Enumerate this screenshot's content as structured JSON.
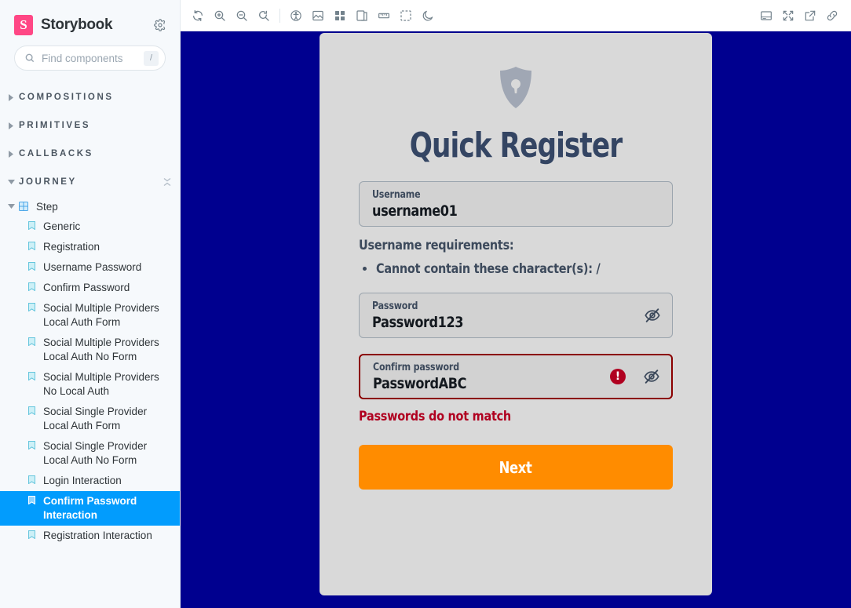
{
  "sidebar": {
    "brand": "Storybook",
    "brand_mark": "S",
    "settings_icon": "gear-icon",
    "search": {
      "placeholder": "Find components",
      "value": "",
      "shortcut": "/"
    },
    "groups": [
      {
        "label": "COMPOSITIONS",
        "expanded": false
      },
      {
        "label": "PRIMITIVES",
        "expanded": false
      },
      {
        "label": "CALLBACKS",
        "expanded": false
      },
      {
        "label": "JOURNEY",
        "expanded": true
      }
    ],
    "component": {
      "label": "Step",
      "expanded": true
    },
    "stories": [
      {
        "label": "Generic",
        "selected": false
      },
      {
        "label": "Registration",
        "selected": false
      },
      {
        "label": "Username Password",
        "selected": false
      },
      {
        "label": "Confirm Password",
        "selected": false
      },
      {
        "label": "Social Multiple Providers Local Auth Form",
        "selected": false
      },
      {
        "label": "Social Multiple Providers Local Auth No Form",
        "selected": false
      },
      {
        "label": "Social Multiple Providers No Local Auth",
        "selected": false
      },
      {
        "label": "Social Single Provider Local Auth Form",
        "selected": false
      },
      {
        "label": "Social Single Provider Local Auth No Form",
        "selected": false
      },
      {
        "label": "Login Interaction",
        "selected": false
      },
      {
        "label": "Confirm Password Interaction",
        "selected": true
      },
      {
        "label": "Registration Interaction",
        "selected": false
      }
    ]
  },
  "toolbar": {
    "left_icons": [
      "remount-icon",
      "zoom-in-icon",
      "zoom-out-icon",
      "zoom-reset-icon",
      "accessibility-icon",
      "backgrounds-icon",
      "grid-icon",
      "viewport-icon",
      "measure-icon",
      "outline-icon",
      "dark-mode-icon"
    ],
    "right_icons": [
      "addons-panel-icon",
      "fullscreen-icon",
      "open-new-tab-icon",
      "copy-link-icon"
    ]
  },
  "preview": {
    "logo_icon": "shield-lock-icon",
    "title": "Quick Register",
    "username_field": {
      "label": "Username",
      "value": "username01",
      "name": "username-input"
    },
    "requirements": {
      "title": "Username requirements:",
      "items": [
        "Cannot contain these character(s): /"
      ]
    },
    "password_field": {
      "label": "Password",
      "value": "Password123",
      "toggle_icon": "eye-off-icon"
    },
    "confirm_field": {
      "label": "Confirm password",
      "value": "PasswordABC",
      "toggle_icon": "eye-off-icon",
      "error_badge": "!",
      "has_error": true
    },
    "error_message": "Passwords do not match",
    "submit_label": "Next",
    "colors": {
      "canvas_background": "#00008f",
      "card_background": "#d9d9d9",
      "submit_button": "#ff8c00",
      "error": "#b00020",
      "text": "#3d4a5c",
      "selected_story": "#029cfd",
      "brand": "#ff4785"
    }
  }
}
